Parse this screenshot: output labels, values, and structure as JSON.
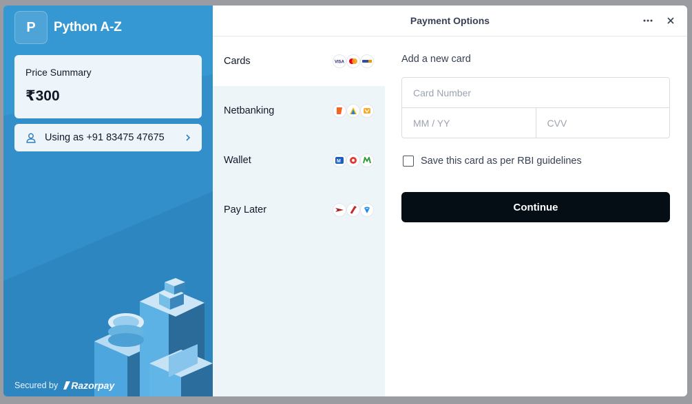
{
  "merchant": {
    "logo_letter": "P",
    "name": "Python A-Z"
  },
  "price_summary": {
    "label": "Price Summary",
    "amount": "₹300"
  },
  "user": {
    "text": "Using as +91 83475 47675",
    "icon": "user-icon"
  },
  "footer": {
    "secured_by": "Secured by",
    "brand": "Razorpay"
  },
  "header": {
    "title": "Payment Options"
  },
  "methods": [
    {
      "label": "Cards",
      "icons": [
        "visa-icon",
        "mastercard-icon",
        "rupay-icon"
      ]
    },
    {
      "label": "Netbanking",
      "icons": [
        "bank-icon",
        "bank-icon",
        "bank-icon"
      ]
    },
    {
      "label": "Wallet",
      "icons": [
        "mobikwik-icon",
        "freecharge-icon",
        "wallet-icon"
      ]
    },
    {
      "label": "Pay Later",
      "icons": [
        "paylater-icon",
        "paylater-icon",
        "paylater-icon"
      ]
    }
  ],
  "form": {
    "title": "Add a new card",
    "card_number_placeholder": "Card Number",
    "expiry_placeholder": "MM / YY",
    "cvv_placeholder": "CVV",
    "save_label": "Save this card as per RBI guidelines",
    "continue_label": "Continue"
  },
  "colors": {
    "brand_blue": "#3698d2",
    "button_dark": "#050e14",
    "method_bg": "#eef5f9"
  }
}
